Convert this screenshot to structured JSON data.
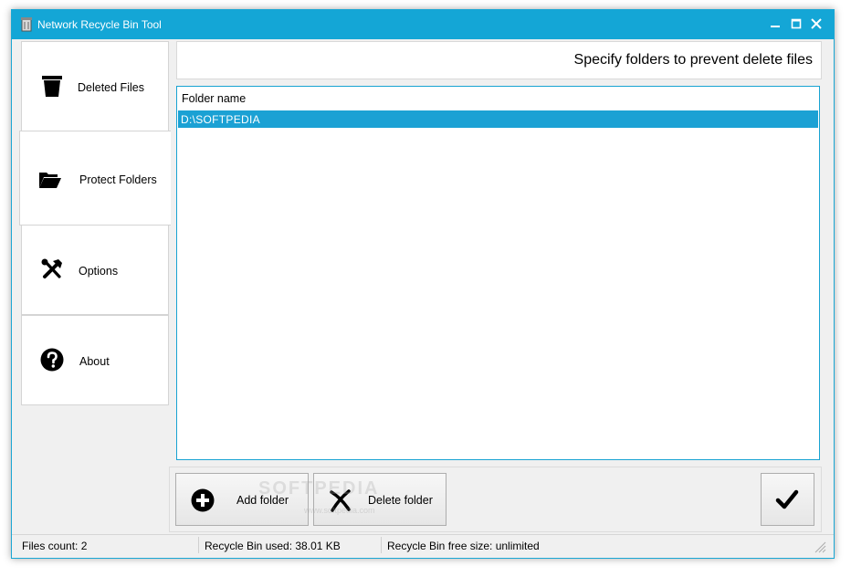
{
  "window": {
    "title": "Network Recycle Bin Tool"
  },
  "sidebar": {
    "items": [
      {
        "label": "Deleted Files",
        "icon": "trash-icon"
      },
      {
        "label": "Protect Folders",
        "icon": "folder-open-icon"
      },
      {
        "label": "Options",
        "icon": "tools-icon"
      },
      {
        "label": "About",
        "icon": "question-icon"
      }
    ],
    "selected": "Protect Folders"
  },
  "header": {
    "title": "Specify folders to prevent delete files"
  },
  "folder_list": {
    "column_header": "Folder name",
    "rows": [
      "D:\\SOFTPEDIA"
    ],
    "selected_row": "D:\\SOFTPEDIA"
  },
  "actions": {
    "add_label": "Add folder",
    "delete_label": "Delete folder",
    "confirm_icon": "checkmark-icon"
  },
  "watermark": {
    "text": "SOFTPEDIA",
    "sub": "www.softpedia.com"
  },
  "status": {
    "files_count": "Files count: 2",
    "bin_used": "Recycle Bin used: 38.01 KB",
    "bin_free": "Recycle Bin free size: unlimited"
  },
  "colors": {
    "accent": "#14a6d6",
    "selection": "#1ba1d4"
  }
}
